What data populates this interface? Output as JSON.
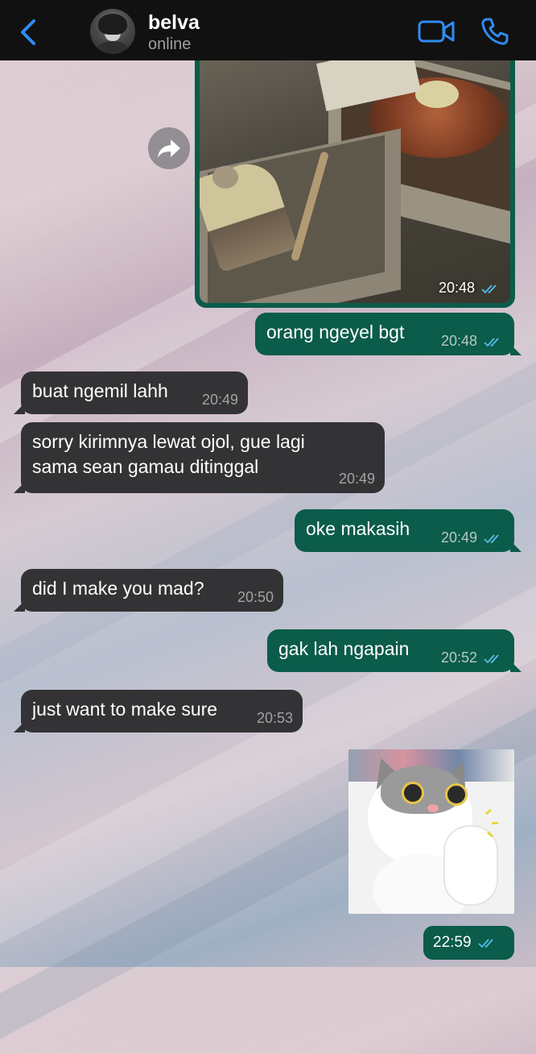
{
  "header": {
    "contact_name": "belva",
    "contact_status": "online"
  },
  "messages": [
    {
      "id": "m1",
      "direction": "outgoing",
      "type": "image",
      "time": "20:48",
      "read": true
    },
    {
      "id": "m2",
      "direction": "outgoing",
      "type": "text",
      "text": "orang ngeyel bgt",
      "time": "20:48",
      "read": true
    },
    {
      "id": "m3",
      "direction": "incoming",
      "type": "text",
      "text": "buat ngemil lahh",
      "time": "20:49"
    },
    {
      "id": "m4",
      "direction": "incoming",
      "type": "text",
      "text_line1": "sorry kirimnya lewat ojol, gue lagi",
      "text_line2": "sama sean gamau ditinggal",
      "time": "20:49"
    },
    {
      "id": "m5",
      "direction": "outgoing",
      "type": "text",
      "text": "oke makasih",
      "time": "20:49",
      "read": true
    },
    {
      "id": "m6",
      "direction": "incoming",
      "type": "text",
      "text": "did I make you mad?",
      "time": "20:50"
    },
    {
      "id": "m7",
      "direction": "outgoing",
      "type": "text",
      "text": "gak lah ngapain",
      "time": "20:52",
      "read": true
    },
    {
      "id": "m8",
      "direction": "incoming",
      "type": "text",
      "text": "just want to make sure",
      "time": "20:53"
    },
    {
      "id": "m9",
      "direction": "outgoing",
      "type": "sticker",
      "time": "22:59",
      "read": true
    }
  ],
  "colors": {
    "outgoing_bubble": "#0b5c4a",
    "incoming_bubble": "#333335",
    "header_bg": "#111111",
    "accent": "#2f8cf2",
    "read_ticks": "#53bdeb"
  },
  "icons": {
    "back": "chevron-left-icon",
    "video": "video-camera-icon",
    "call": "phone-icon",
    "forward": "forward-arrow-icon",
    "ticks": "double-check-icon"
  }
}
